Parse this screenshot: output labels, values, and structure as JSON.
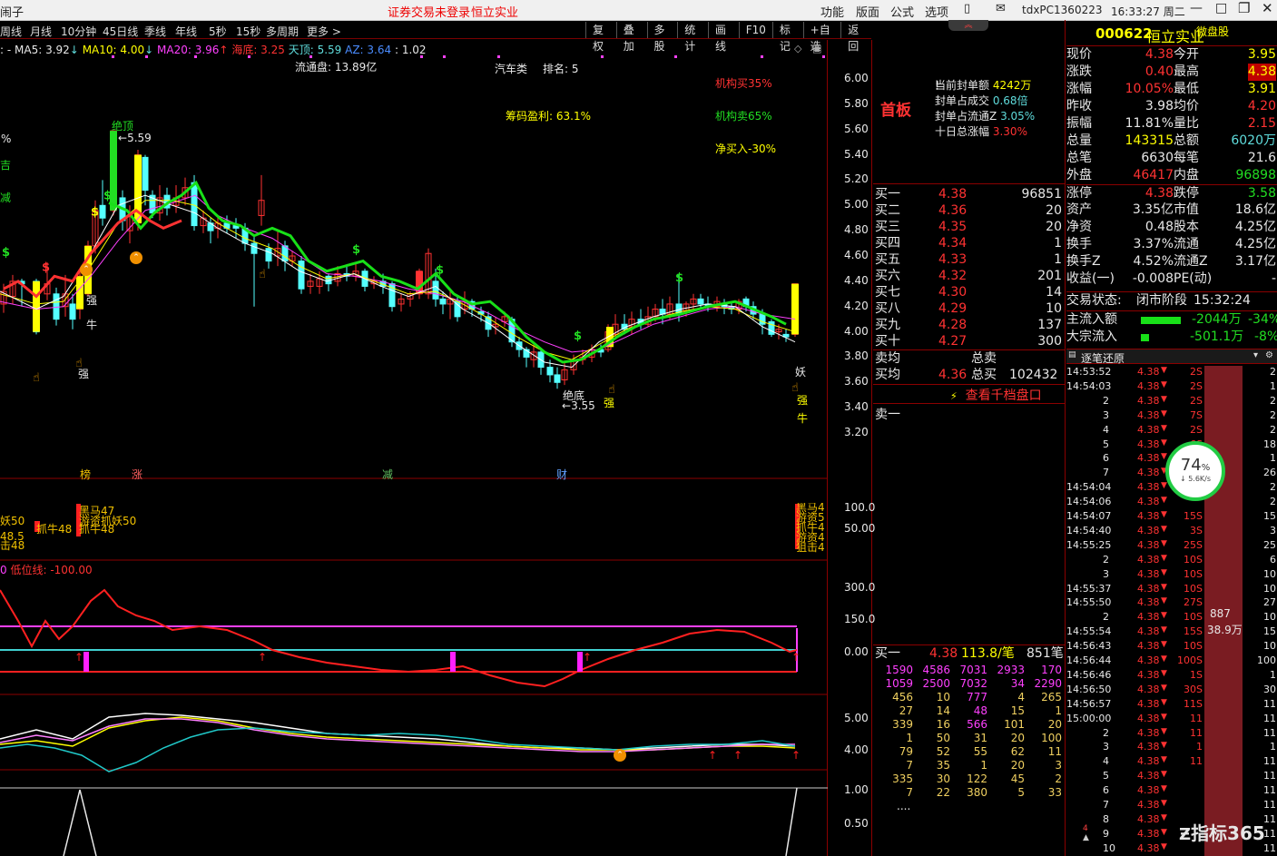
{
  "titlebar": {
    "left_text": "闹子",
    "notice": "证券交易未登录",
    "stock_name": "恒立实业",
    "menus": [
      "功能",
      "版面",
      "公式",
      "选项"
    ],
    "server": "tdxPC1360223",
    "clock": "16:33:27 周二"
  },
  "periods": [
    "周线",
    "月线",
    "10分钟",
    "45日线",
    "季线",
    "年线",
    "5秒",
    "15秒",
    "多周期",
    "更多"
  ],
  "tools": [
    "复权",
    "叠加",
    "多股",
    "统计",
    "画线",
    "F10",
    "标记",
    "+自选",
    "返回"
  ],
  "ma_legend": {
    "ma5": "MA5: 3.92",
    "ma10": "MA10: 4.00",
    "ma20": "MA20: 3.96",
    "haidi": "海底: 3.25",
    "tianding": "天顶: 5.59",
    "az": "AZ: 3.64",
    "ratio": ": 1.02",
    "colors": {
      "ma5": "#ffffff",
      "ma10": "#ffff00",
      "ma20": "#ff40ff",
      "haidi": "#ff3232",
      "tianding": "#00ffff"
    }
  },
  "chart_annotations": {
    "float_cap": "流通盘: 13.89亿",
    "industry": "汽车类",
    "rank": "排名: 5",
    "chip_profit": "筹码盈利: 63.1%",
    "inst_buy": "机构买35%",
    "inst_sell": "机构卖65%",
    "net_buy": "净买入-30%",
    "peak": "绝顶",
    "peak_value": "5.59",
    "bottom": "绝底",
    "bottom_value": "3.55",
    "strong": "强",
    "bull": "牛",
    "demon": "妖",
    "tags": [
      "榜",
      "涨",
      "减",
      "财"
    ],
    "left_fragments": [
      "%",
      "吉",
      "减"
    ]
  },
  "main_axis": [
    "6.00",
    "5.80",
    "5.60",
    "5.40",
    "5.20",
    "5.00",
    "4.80",
    "4.60",
    "4.40",
    "4.20",
    "4.00",
    "3.80",
    "3.60",
    "3.40",
    "3.20"
  ],
  "panel2": {
    "axis": [
      "100.0",
      "50.00"
    ],
    "labels_left": [
      "妖50",
      "48.5",
      "抓牛48",
      "击48"
    ],
    "labels_mid": [
      "黑马47",
      "游资抓妖50",
      "抓牛48"
    ],
    "labels_right": [
      "黑马4",
      "游资5",
      "抓牛4",
      "游资4",
      "狙击4"
    ]
  },
  "panel3": {
    "title_prefix": "0",
    "title": "低位线: -100.00",
    "axis": [
      "300.0",
      "150.0",
      "0.00"
    ]
  },
  "panel4": {
    "axis": [
      "5.00",
      "4.00"
    ]
  },
  "panel5": {
    "axis": [
      "1.00",
      "0.50"
    ]
  },
  "mid": {
    "shouban": "首板",
    "seal_info": [
      {
        "label": "当前封单额",
        "value": "4242万"
      },
      {
        "label": "封单占成交",
        "value": "0.68倍"
      },
      {
        "label": "封单占流通Z",
        "value": "3.05%"
      },
      {
        "label": "十日总涨幅",
        "value": "3.30%"
      }
    ],
    "bids": [
      {
        "label": "买一",
        "price": "4.38",
        "vol": "96851"
      },
      {
        "label": "买二",
        "price": "4.36",
        "vol": "20"
      },
      {
        "label": "买三",
        "price": "4.35",
        "vol": "20"
      },
      {
        "label": "买四",
        "price": "4.34",
        "vol": "1"
      },
      {
        "label": "买五",
        "price": "4.33",
        "vol": "1"
      },
      {
        "label": "买六",
        "price": "4.32",
        "vol": "201"
      },
      {
        "label": "买七",
        "price": "4.30",
        "vol": "14"
      },
      {
        "label": "买八",
        "price": "4.29",
        "vol": "10"
      },
      {
        "label": "买九",
        "price": "4.28",
        "vol": "137"
      },
      {
        "label": "买十",
        "price": "4.27",
        "vol": "300"
      }
    ],
    "sell_avg_label": "卖均",
    "total_sell_label": "总卖",
    "buy_avg_label": "买均",
    "buy_avg": "4.36",
    "total_buy_label": "总买",
    "total_buy": "102432",
    "depth_link": "查看千档盘口",
    "sell1": "卖一",
    "queue_label": "买一",
    "queue_price": "4.38",
    "queue_avg": "113.8/笔",
    "queue_count": "851笔",
    "queue": [
      [
        "1590",
        "4586",
        "7031",
        "2933",
        "170"
      ],
      [
        "1059",
        "2500",
        "7032",
        "34",
        "2290"
      ],
      [
        "456",
        "10",
        "777",
        "4",
        "265"
      ],
      [
        "27",
        "14",
        "48",
        "15",
        "1"
      ],
      [
        "339",
        "16",
        "566",
        "101",
        "20"
      ],
      [
        "1",
        "50",
        "31",
        "20",
        "100"
      ],
      [
        "79",
        "52",
        "55",
        "62",
        "11"
      ],
      [
        "7",
        "35",
        "1",
        "20",
        "3"
      ],
      [
        "335",
        "30",
        "122",
        "45",
        "2"
      ],
      [
        "7",
        "22",
        "380",
        "5",
        "33"
      ]
    ],
    "more": "...."
  },
  "quote": {
    "code": "000622",
    "name": "恒立实业",
    "badge": "微盘股",
    "rows": [
      [
        "现价",
        "4.38",
        "今开",
        "3.95"
      ],
      [
        "涨跌",
        "0.40",
        "最高",
        "4.38"
      ],
      [
        "涨幅",
        "10.05%",
        "最低",
        "3.91"
      ],
      [
        "昨收",
        "3.98",
        "均价",
        "4.20"
      ],
      [
        "振幅",
        "11.81%",
        "量比",
        "2.15"
      ],
      [
        "总量",
        "143315",
        "总额",
        "6020万"
      ],
      [
        "总笔",
        "6630",
        "每笔",
        "21.6"
      ],
      [
        "外盘",
        "46417",
        "内盘",
        "96898"
      ],
      [
        "涨停",
        "4.38",
        "跌停",
        "3.58"
      ],
      [
        "资产",
        "3.35亿",
        "市值",
        "18.6亿"
      ],
      [
        "净资",
        "0.48",
        "股本",
        "4.25亿"
      ],
      [
        "换手",
        "3.37%",
        "流通",
        "4.25亿"
      ],
      [
        "换手Z",
        "4.52%",
        "流通Z",
        "3.17亿"
      ],
      [
        "收益(一)",
        "-0.008",
        "PE(动)",
        "-"
      ]
    ],
    "trade_state_label": "交易状态:",
    "trade_state": "闭市阶段",
    "trade_time": "15:32:24",
    "main_flow_label": "主流入额",
    "main_flow": "-2044万",
    "main_flow_pct": "-34%",
    "block_flow_label": "大宗流入",
    "block_flow": "-501.1万",
    "block_flow_pct": "-8%",
    "ticks_title": "逐笔还原",
    "ticks": [
      [
        "14:53:52",
        "4.38",
        "2S",
        "2"
      ],
      [
        "14:54:03",
        "4.38",
        "2S",
        "1"
      ],
      [
        "2",
        "4.38",
        "2S",
        "2"
      ],
      [
        "3",
        "4.38",
        "7S",
        "2"
      ],
      [
        "4",
        "4.38",
        "2S",
        "2"
      ],
      [
        "5",
        "4.38",
        "6S",
        "18"
      ],
      [
        "6",
        "4.38",
        "2S",
        "1"
      ],
      [
        "7",
        "4.38",
        "",
        "26"
      ],
      [
        "14:54:04",
        "4.38",
        "",
        "2"
      ],
      [
        "14:54:06",
        "4.38",
        "",
        "2"
      ],
      [
        "14:54:07",
        "4.38",
        "15S",
        "15"
      ],
      [
        "14:54:40",
        "4.38",
        "3S",
        "3"
      ],
      [
        "14:55:25",
        "4.38",
        "25S",
        "25"
      ],
      [
        "2",
        "4.38",
        "10S",
        "6"
      ],
      [
        "3",
        "4.38",
        "10S",
        "10"
      ],
      [
        "14:55:37",
        "4.38",
        "10S",
        "10"
      ],
      [
        "14:55:50",
        "4.38",
        "27S",
        "27"
      ],
      [
        "2",
        "4.38",
        "10S",
        "10"
      ],
      [
        "14:55:54",
        "4.38",
        "15S",
        "15"
      ],
      [
        "14:56:43",
        "4.38",
        "10S",
        "10"
      ],
      [
        "14:56:44",
        "4.38",
        "100S",
        "100"
      ],
      [
        "14:56:46",
        "4.38",
        "1S",
        "1"
      ],
      [
        "14:56:50",
        "4.38",
        "30S",
        "30"
      ],
      [
        "14:56:57",
        "4.38",
        "11S",
        "11"
      ],
      [
        "15:00:00",
        "4.38",
        "11",
        "11"
      ],
      [
        "2",
        "4.38",
        "11",
        "11"
      ],
      [
        "3",
        "4.38",
        "1",
        "1"
      ],
      [
        "4",
        "4.38",
        "11",
        "11"
      ],
      [
        "5",
        "4.38",
        "",
        "11"
      ],
      [
        "6",
        "4.38",
        "",
        "11"
      ],
      [
        "7",
        "4.38",
        "",
        "11"
      ],
      [
        "8",
        "4.38",
        "",
        "11"
      ],
      [
        "9",
        "4.38",
        "",
        "11"
      ],
      [
        "10",
        "4.38",
        "",
        "11"
      ]
    ],
    "bar_label_1": "887",
    "bar_label_2": "38.9万",
    "net_percent": "74",
    "net_percent_unit": "%",
    "net_speed": "5.6K/s",
    "watermark": "指标365"
  }
}
